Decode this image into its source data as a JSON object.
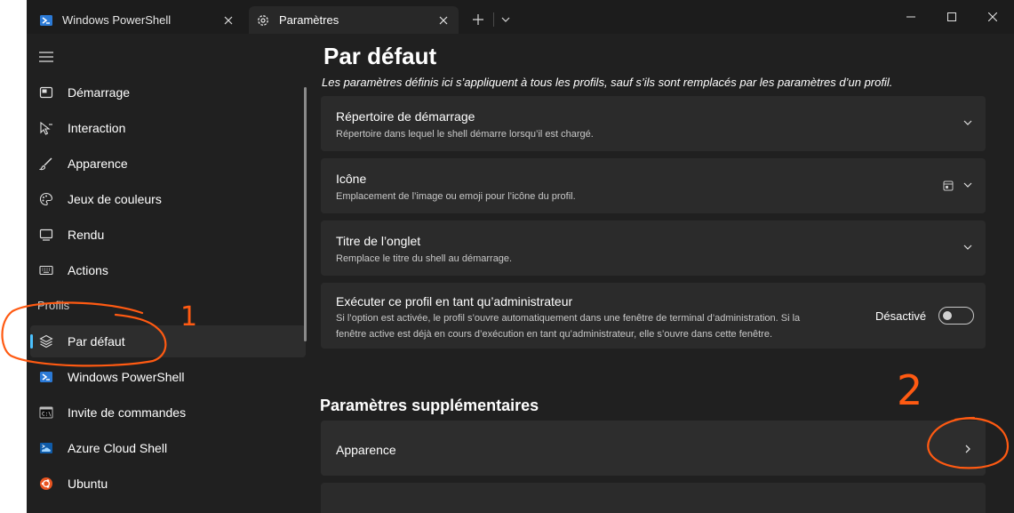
{
  "tabs": [
    {
      "label": "Windows PowerShell",
      "icon": "powershell-icon",
      "active": false
    },
    {
      "label": "Paramètres",
      "icon": "gear-icon",
      "active": true
    }
  ],
  "sidebar": {
    "items": [
      {
        "label": "Démarrage",
        "icon": "startup-icon"
      },
      {
        "label": "Interaction",
        "icon": "interaction-icon"
      },
      {
        "label": "Apparence",
        "icon": "brush-icon"
      },
      {
        "label": "Jeux de couleurs",
        "icon": "palette-icon"
      },
      {
        "label": "Rendu",
        "icon": "monitor-icon"
      },
      {
        "label": "Actions",
        "icon": "keyboard-icon"
      }
    ],
    "profiles_header": "Profils",
    "profiles": [
      {
        "label": "Par défaut",
        "icon": "layers-icon",
        "selected": true
      },
      {
        "label": "Windows PowerShell",
        "icon": "powershell-icon"
      },
      {
        "label": "Invite de commandes",
        "icon": "cmd-icon"
      },
      {
        "label": "Azure Cloud Shell",
        "icon": "azure-icon"
      },
      {
        "label": "Ubuntu",
        "icon": "ubuntu-icon"
      }
    ]
  },
  "main": {
    "title": "Par défaut",
    "description": "Les paramètres définis ici s’appliquent à tous les profils, sauf s’ils sont remplacés par les paramètres d’un profil.",
    "cards": [
      {
        "title": "Répertoire de démarrage",
        "description": "Répertoire dans lequel le shell démarre lorsqu’il est chargé."
      },
      {
        "title": "Icône",
        "description": "Emplacement de l’image ou emoji pour l’icône du profil."
      },
      {
        "title": "Titre de l’onglet",
        "description": "Remplace le titre du shell au démarrage."
      },
      {
        "title": "Exécuter ce profil en tant qu’administrateur",
        "description_line1": "Si l’option est activée, le profil s’ouvre automatiquement dans une fenêtre de terminal d’administration. Si la",
        "description_line2": "fenêtre active est déjà en cours d’exécution en tant qu’administrateur, elle s’ouvre dans cette fenêtre.",
        "toggle_label": "Désactivé",
        "toggle_on": false
      }
    ],
    "section_title": "Paramètres supplémentaires",
    "additional": [
      {
        "title": "Apparence"
      }
    ]
  },
  "annotations": {
    "mark1": "1",
    "mark2": "2",
    "color": "#ff5a12"
  },
  "colors": {
    "accent": "#4cc2ff",
    "background": "#202020",
    "card": "#2b2b2b"
  }
}
